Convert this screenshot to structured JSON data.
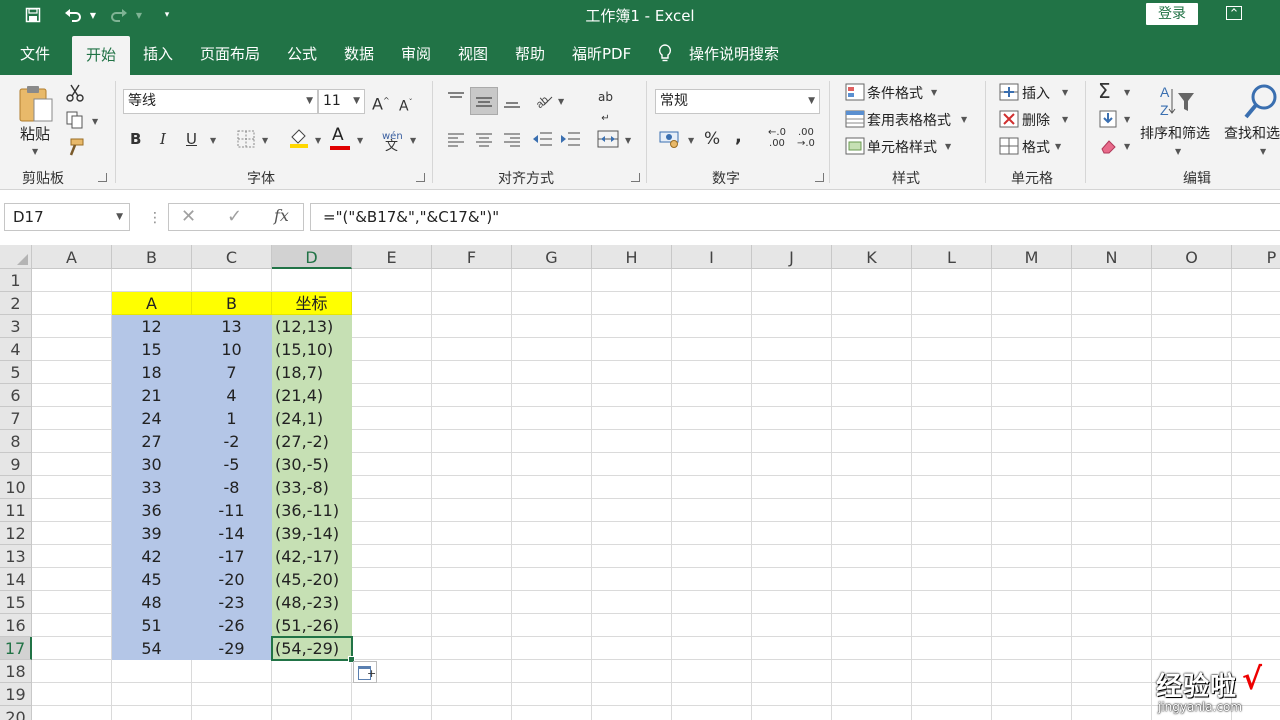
{
  "window": {
    "title": "工作簿1  -  Excel",
    "login": "登录"
  },
  "tabs": [
    "文件",
    "开始",
    "插入",
    "页面布局",
    "公式",
    "数据",
    "审阅",
    "视图",
    "帮助",
    "福昕PDF"
  ],
  "tell_me": "操作说明搜索",
  "ribbon": {
    "clipboard": {
      "paste": "粘贴",
      "label": "剪贴板"
    },
    "font": {
      "name": "等线",
      "size": "11",
      "grow": "A",
      "shrink": "A",
      "bold": "B",
      "italic": "I",
      "underline": "U",
      "color_letter": "A",
      "phonetic": "wén",
      "label": "字体"
    },
    "alignment": {
      "label": "对齐方式",
      "wrap_glyph": "ab"
    },
    "number": {
      "format": "常规",
      "percent": "%",
      "comma": ",",
      "inc_dec": ".00",
      "dec_dec": ".0",
      "label": "数字"
    },
    "styles": {
      "cond": "条件格式",
      "table": "套用表格格式",
      "cell": "单元格样式",
      "label": "样式"
    },
    "cells": {
      "insert": "插入",
      "delete": "删除",
      "format": "格式",
      "label": "单元格"
    },
    "editing": {
      "sort": "排序和筛选",
      "find": "查找和选",
      "label": "编辑",
      "sum": "Σ"
    }
  },
  "formula_bar": {
    "name_box": "D17",
    "cancel": "✕",
    "enter": "✓",
    "fx": "fx",
    "formula": "=\"(\"&B17&\",\"&C17&\")\""
  },
  "columns": [
    "A",
    "B",
    "C",
    "D",
    "E",
    "F",
    "G",
    "H",
    "I",
    "J",
    "K",
    "L",
    "M",
    "N",
    "O",
    "P"
  ],
  "rows": [
    "1",
    "2",
    "3",
    "4",
    "5",
    "6",
    "7",
    "8",
    "9",
    "10",
    "11",
    "12",
    "13",
    "14",
    "15",
    "16",
    "17",
    "18",
    "19",
    "20"
  ],
  "headers": {
    "b": "A",
    "c": "B",
    "d": "坐标"
  },
  "table": [
    [
      "12",
      "13",
      "(12,13)"
    ],
    [
      "15",
      "10",
      "(15,10)"
    ],
    [
      "18",
      "7",
      "(18,7)"
    ],
    [
      "21",
      "4",
      "(21,4)"
    ],
    [
      "24",
      "1",
      "(24,1)"
    ],
    [
      "27",
      "-2",
      "(27,-2)"
    ],
    [
      "30",
      "-5",
      "(30,-5)"
    ],
    [
      "33",
      "-8",
      "(33,-8)"
    ],
    [
      "36",
      "-11",
      "(36,-11)"
    ],
    [
      "39",
      "-14",
      "(39,-14)"
    ],
    [
      "42",
      "-17",
      "(42,-17)"
    ],
    [
      "45",
      "-20",
      "(45,-20)"
    ],
    [
      "48",
      "-23",
      "(48,-23)"
    ],
    [
      "51",
      "-26",
      "(51,-26)"
    ],
    [
      "54",
      "-29",
      "(54,-29)"
    ]
  ],
  "watermark": {
    "main": "经验啦",
    "sub": "jingyanla.com",
    "check": "√"
  },
  "colors": {
    "accent": "#217346",
    "header_fill": "#ffff00",
    "ab_fill": "#b4c6e7",
    "coord_fill": "#c6e0b4"
  }
}
